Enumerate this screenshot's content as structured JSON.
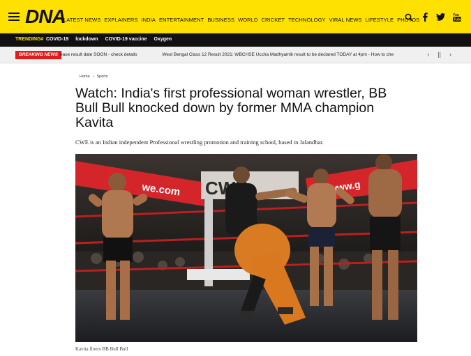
{
  "brand": {
    "logo": "DNA"
  },
  "nav": {
    "items": [
      "LATEST NEWS",
      "EXPLAINERS",
      "INDIA",
      "ENTERTAINMENT",
      "BUSINESS",
      "WORLD",
      "CRICKET",
      "TECHNOLOGY",
      "VIRAL NEWS",
      "LIFESTYLE",
      "PHOTOS"
    ]
  },
  "top_icons": [
    "search-icon",
    "facebook-icon",
    "twitter-icon",
    "youtube-icon"
  ],
  "trending": {
    "label": "TRENDING#",
    "items": [
      "COVID-19",
      "lockdown",
      "COVID-19 vaccine",
      "Oxygen"
    ]
  },
  "breaking": {
    "label": "BREAKING NEWS",
    "items": [
      "ease result date SOON - check details",
      "West Bengal Class 12 Result 2021: WBCHSE Uccha Madhyamik result to be declared TODAY at 4pm - How to che"
    ],
    "prev": "‹",
    "pause": "||",
    "next": "›"
  },
  "article": {
    "breadcrumb": [
      "Home",
      "›",
      "Sports"
    ],
    "headline": "Watch: India's first professional woman wrestler, BB Bull Bull knocked down by former MMA champion Kavita",
    "dek": "CWE is an Indian independent Professional wrestling promotion and training school, based in Jalandhar.",
    "caption": "Kavita floors BB Bull Bull",
    "banner_text_left": "we.com",
    "banner_text_mid": "CWE",
    "banner_text_right": "www.g"
  },
  "colors": {
    "brand_yellow": "#ffe100",
    "trending_bg": "#111111",
    "breaking_red": "#e21b1b"
  }
}
